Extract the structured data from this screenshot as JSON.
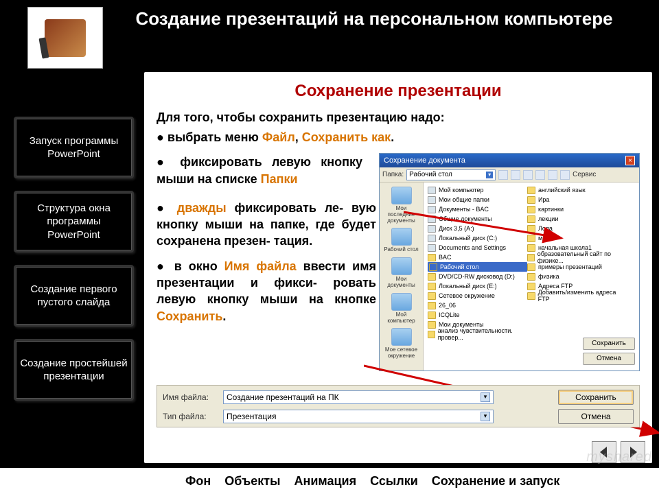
{
  "header": {
    "title": "Создание презентаций на персональном компьютере"
  },
  "sidebar": {
    "items": [
      {
        "label": "Запуск программы PowerPoint"
      },
      {
        "label": "Структура окна программы PowerPoint"
      },
      {
        "label": "Создание первого пустого слайда"
      },
      {
        "label": "Создание простейшей презентации"
      }
    ]
  },
  "content": {
    "subtitle": "Сохранение презентации",
    "intro": "Для того, чтобы сохранить презентацию надо:",
    "b1_pre": "● выбрать меню ",
    "b1_file": "Файл",
    "b1_sep": ", ",
    "b1_saveas": "Сохранить как",
    "b1_end": ".",
    "b2_pre": "● фиксировать левую кнопку мыши на списке ",
    "b2_key": "Папки",
    "b3_pre": "● ",
    "b3_key": "дважды",
    "b3_rest": " фиксировать ле- вую кнопку мыши на папке, где будет сохранена презен- тация.",
    "b4_pre": "● в окно ",
    "b4_key1": "Имя файла",
    "b4_mid": " ввести имя презентации и фикси- ровать левую кнопку мыши на кнопке ",
    "b4_key2": "Сохранить",
    "b4_end": "."
  },
  "dialog": {
    "title": "Сохранение документа",
    "folder_label": "Папка:",
    "folder_value": "Рабочий стол",
    "service": "Сервис",
    "places": [
      "Мои последние документы",
      "Рабочий стол",
      "Мои документы",
      "Мой компьютер",
      "Мое сетевое окружение"
    ],
    "files": [
      "Мой компьютер",
      "Мои общие папки",
      "Документы - BAC",
      "Общие документы",
      "Диск 3,5 (A:)",
      "Локальный диск (C:)",
      "Documents and Settings",
      "BAC",
      "Рабочий стол",
      "DVD/CD-RW дисковод (D:)",
      "Локальный диск (E:)",
      "Сетевое окружение",
      "26_06",
      "ICQLite",
      "Мои документы",
      "анализ чувствительности. провер...",
      "английский язык",
      "Ира",
      "картинки",
      "лекции",
      "Лола",
      "макро",
      "начальная школа1",
      "образовательный сайт по физике...",
      "примеры презентаций",
      "физика",
      "Адреса FTP",
      "Добавить/изменить адреса FTP"
    ],
    "selected_index": 8,
    "btn_save": "Сохранить",
    "btn_cancel": "Отмена"
  },
  "save_panel": {
    "name_label": "Имя файла:",
    "name_value": "Создание презентаций на ПК",
    "type_label": "Тип файла:",
    "type_value": "Презентация",
    "btn_save": "Сохранить",
    "btn_cancel": "Отмена"
  },
  "bottom_nav": [
    "Фон",
    "Объекты",
    "Анимация",
    "Ссылки",
    "Сохранение и запуск"
  ],
  "watermark": "myshared"
}
